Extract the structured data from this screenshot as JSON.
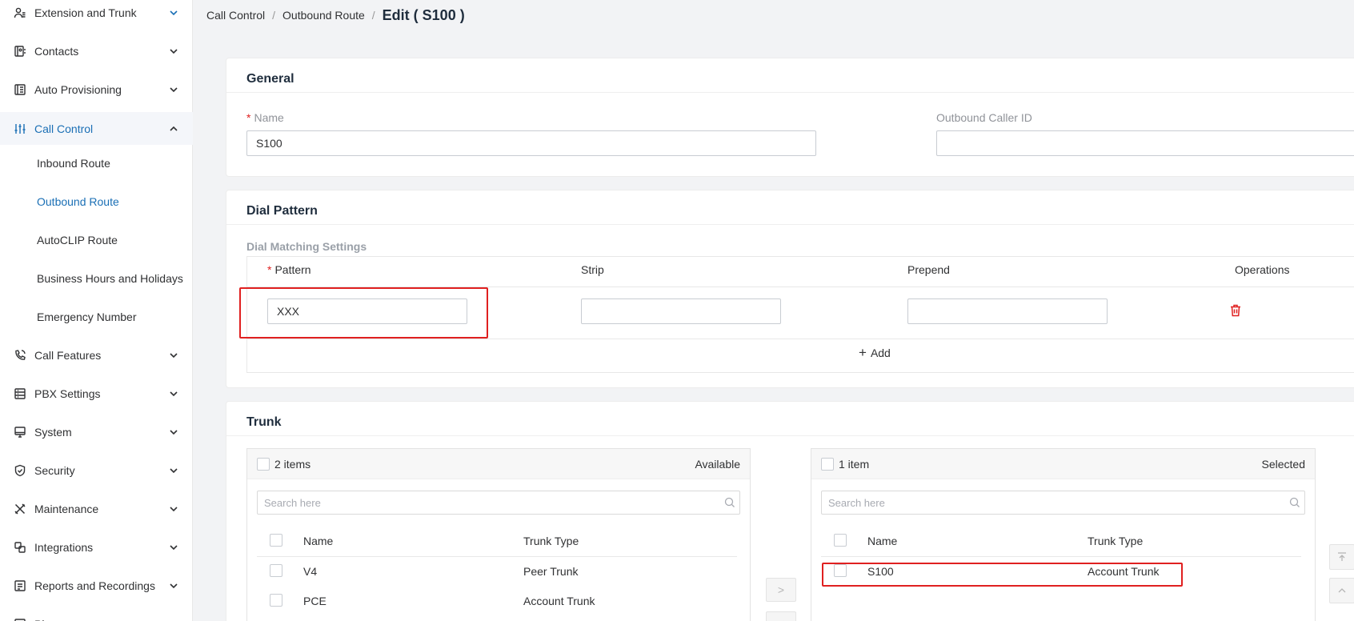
{
  "sidebar": {
    "items": [
      {
        "label": "Extension and Trunk",
        "icon": "user-group-icon",
        "chevron": "down-blue"
      },
      {
        "label": "Contacts",
        "icon": "contacts-book-icon",
        "chevron": "down"
      },
      {
        "label": "Auto Provisioning",
        "icon": "provisioning-icon",
        "chevron": "down"
      },
      {
        "label": "Call Control",
        "icon": "sliders-icon",
        "chevron": "up"
      },
      {
        "label": "Call Features",
        "icon": "phone-icon",
        "chevron": "down"
      },
      {
        "label": "PBX Settings",
        "icon": "server-icon",
        "chevron": "down"
      },
      {
        "label": "System",
        "icon": "monitor-icon",
        "chevron": "down"
      },
      {
        "label": "Security",
        "icon": "shield-icon",
        "chevron": "down"
      },
      {
        "label": "Maintenance",
        "icon": "tools-icon",
        "chevron": "down"
      },
      {
        "label": "Integrations",
        "icon": "integrations-icon",
        "chevron": "down"
      },
      {
        "label": "Reports and Recordings",
        "icon": "reports-icon",
        "chevron": "down"
      },
      {
        "label": "Pl",
        "icon": "plugin-icon",
        "chevron": "none"
      }
    ],
    "call_control_sub": [
      {
        "label": "Inbound Route"
      },
      {
        "label": "Outbound Route"
      },
      {
        "label": "AutoCLIP Route"
      },
      {
        "label": "Business Hours and Holidays"
      },
      {
        "label": "Emergency Number"
      }
    ]
  },
  "breadcrumb": {
    "part1": "Call Control",
    "part2": "Outbound Route",
    "current": "Edit ( S100 )",
    "separator": "/"
  },
  "general": {
    "title": "General",
    "name_label": "Name",
    "name_value": "S100",
    "caller_id_label": "Outbound Caller ID",
    "caller_id_value": ""
  },
  "dial_pattern": {
    "title": "Dial Pattern",
    "subtitle": "Dial Matching Settings",
    "columns": {
      "pattern": "Pattern",
      "strip": "Strip",
      "prepend": "Prepend",
      "operations": "Operations"
    },
    "row": {
      "pattern": "XXX",
      "strip": "",
      "prepend": ""
    },
    "add_label": "Add"
  },
  "trunk": {
    "title": "Trunk",
    "available": {
      "count": "2 items",
      "title": "Available",
      "search_placeholder": "Search here",
      "col_name": "Name",
      "col_type": "Trunk Type",
      "rows": [
        {
          "name": "V4",
          "type": "Peer Trunk"
        },
        {
          "name": "PCE",
          "type": "Account Trunk"
        }
      ]
    },
    "selected": {
      "count": "1 item",
      "title": "Selected",
      "search_placeholder": "Search here",
      "col_name": "Name",
      "col_type": "Trunk Type",
      "rows": [
        {
          "name": "S100",
          "type": "Account Trunk"
        }
      ]
    },
    "move_right_glyph": ">",
    "move_left_glyph": "<"
  },
  "colors": {
    "accent": "#1a6fb5",
    "required": "#e02020",
    "highlight": "#e02020"
  }
}
